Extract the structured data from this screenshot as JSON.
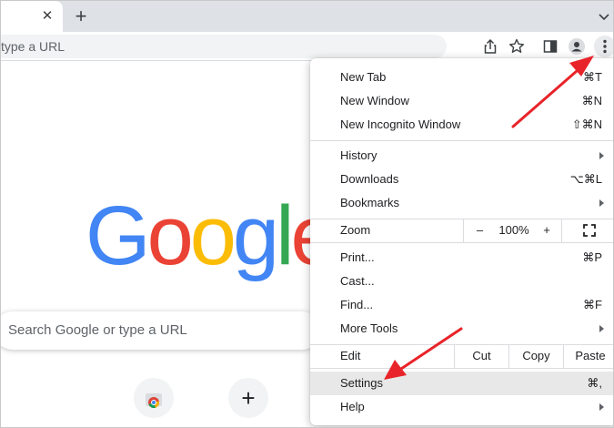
{
  "tabstrip": {
    "close_icon": "close-icon",
    "new_tab_glyph": "+",
    "tab_list_icon": "chevron-down-icon"
  },
  "toolbar": {
    "omnibox_text": "type a URL",
    "icons": [
      "share-icon",
      "bookmark-star-icon",
      "side-panel-icon",
      "profile-icon",
      "kebab-menu-icon"
    ]
  },
  "ntp": {
    "logo": [
      "G",
      "o",
      "o",
      "g",
      "l",
      "e"
    ],
    "logo_colors": [
      "#4285F4",
      "#EA4335",
      "#FBBC05",
      "#4285F4",
      "#34A853",
      "#EA4335"
    ],
    "search_placeholder": "Search Google or type a URL",
    "add_shortcut_glyph": "+",
    "shortcut_icon": "chrome-web-store-icon"
  },
  "menu": {
    "new_tab": {
      "label": "New Tab",
      "shortcut": "⌘T"
    },
    "new_window": {
      "label": "New Window",
      "shortcut": "⌘N"
    },
    "new_incognito": {
      "label": "New Incognito Window",
      "shortcut": "⇧⌘N"
    },
    "history": {
      "label": "History"
    },
    "downloads": {
      "label": "Downloads",
      "shortcut": "⌥⌘L"
    },
    "bookmarks": {
      "label": "Bookmarks"
    },
    "zoom": {
      "label": "Zoom",
      "minus": "–",
      "value": "100%",
      "plus": "+",
      "fullscreen_icon": "fullscreen-icon"
    },
    "print": {
      "label": "Print...",
      "shortcut": "⌘P"
    },
    "cast": {
      "label": "Cast..."
    },
    "find": {
      "label": "Find...",
      "shortcut": "⌘F"
    },
    "more_tools": {
      "label": "More Tools"
    },
    "edit": {
      "label": "Edit",
      "cut": "Cut",
      "copy": "Copy",
      "paste": "Paste"
    },
    "settings": {
      "label": "Settings",
      "shortcut": "⌘,"
    },
    "help": {
      "label": "Help"
    }
  },
  "colors": {
    "annotation_arrow": "#e8242a",
    "menu_highlight": "#e8e8e8",
    "tabstrip": "#dee1e6"
  }
}
